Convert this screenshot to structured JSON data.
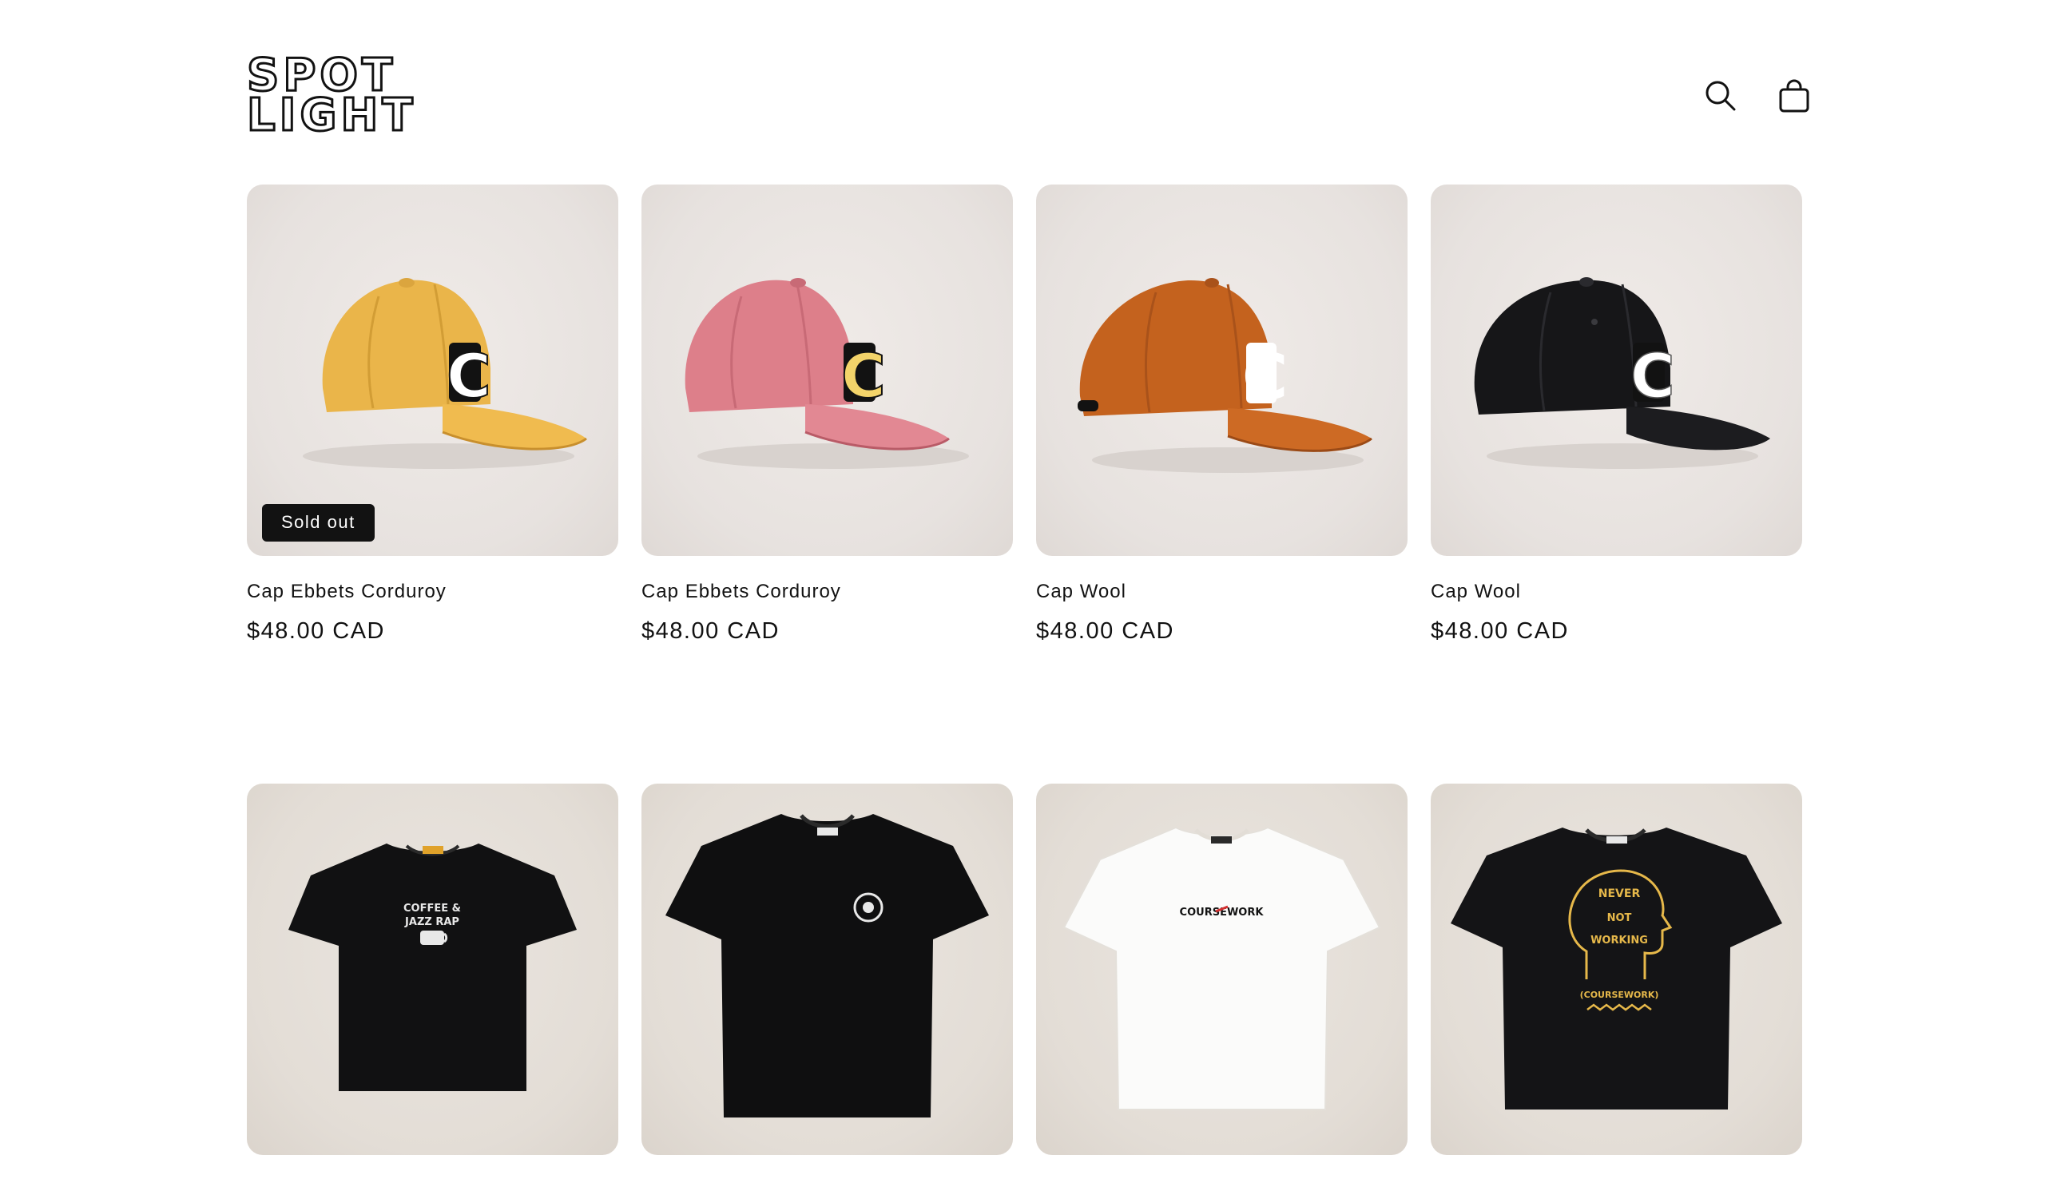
{
  "header": {
    "logo_line1": "SPOT",
    "logo_line2": "LIGHT",
    "search_icon": "search-icon",
    "cart_icon": "cart-icon"
  },
  "colors": {
    "text": "#121212",
    "badge_bg": "#121212",
    "page_bg": "#ffffff"
  },
  "products": [
    {
      "title": "Cap Ebbets Corduroy",
      "price": "$48.00 CAD",
      "badge": "Sold out",
      "image": "yellow-cap"
    },
    {
      "title": "Cap Ebbets Corduroy",
      "price": "$48.00 CAD",
      "image": "pink-cap"
    },
    {
      "title": "Cap Wool",
      "price": "$48.00 CAD",
      "image": "orange-cap"
    },
    {
      "title": "Cap Wool",
      "price": "$48.00 CAD",
      "image": "black-cap"
    },
    {
      "title": "",
      "price": "",
      "image": "black-tee-coffee-jazz-rap",
      "print": [
        "COFFEE &",
        "JAZZ RAP"
      ]
    },
    {
      "title": "",
      "price": "",
      "image": "black-tee-coursework-logo"
    },
    {
      "title": "",
      "price": "",
      "image": "white-tee-coursework",
      "print": [
        "COURSEWORK"
      ]
    },
    {
      "title": "",
      "price": "",
      "image": "black-tee-never-not-working",
      "print": [
        "NEVER",
        "NOT",
        "WORKING",
        "(COURSEWORK)"
      ]
    }
  ]
}
